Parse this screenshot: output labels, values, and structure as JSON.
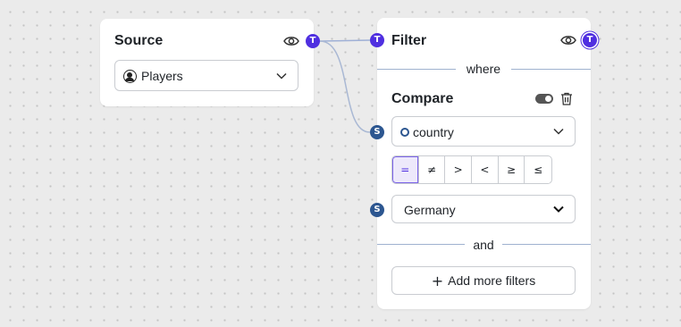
{
  "source_node": {
    "title": "Source",
    "table_select": {
      "value": "Players",
      "icon": "players-icon"
    },
    "output_handle": "T"
  },
  "filter_node": {
    "title": "Filter",
    "input_handle": "T",
    "output_handle": "T",
    "where_label": "where",
    "compare": {
      "title": "Compare",
      "column_handle": "S",
      "column_select": {
        "value": "country",
        "icon": "column-circle-icon"
      },
      "operators": [
        "=",
        "≠",
        ">",
        "<",
        "≥",
        "≤"
      ],
      "active_operator": "=",
      "value_handle": "S",
      "value_select": {
        "value": "Germany"
      }
    },
    "and_label": "and",
    "add_button": {
      "icon": "+",
      "label": "Add more filters"
    }
  },
  "colors": {
    "table_handle": "#4f2fe0",
    "scalar_handle": "#2c5690",
    "wire": "#a9b8d4",
    "canvas": "#ebebeb"
  }
}
